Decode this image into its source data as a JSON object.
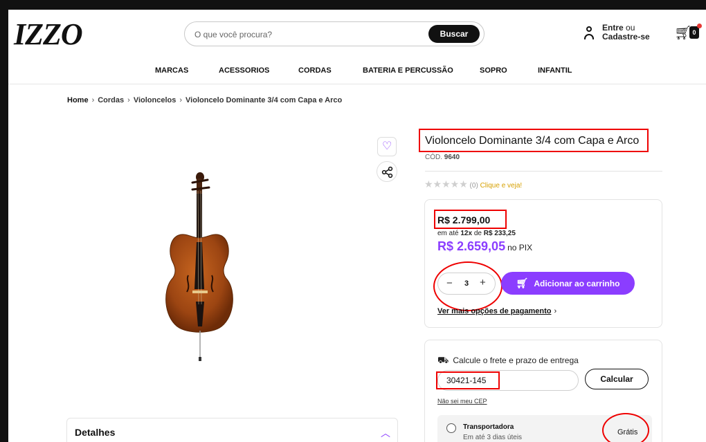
{
  "header": {
    "logo": "IZZO",
    "search_placeholder": "O que você procura?",
    "search_button": "Buscar",
    "account_line1_bold": "Entre",
    "account_line1_rest": " ou",
    "account_line2": "Cadastre-se",
    "cart_count": "0"
  },
  "nav": {
    "items": [
      "MARCAS",
      "ACESSORIOS",
      "CORDAS",
      "BATERIA E PERCUSSÃO",
      "SOPRO",
      "INFANTIL"
    ]
  },
  "breadcrumb": {
    "home": "Home",
    "items": [
      "Cordas",
      "Violoncelos",
      "Violoncelo Dominante 3/4 com Capa e Arco"
    ]
  },
  "product": {
    "title": "Violoncelo Dominante 3/4 com Capa e Arco",
    "code_label": "CÓD.",
    "code_value": "9640",
    "rating_count": "(0)",
    "rating_link": "Clique e veja!",
    "price": "R$ 2.799,00",
    "installment_prefix": "em até ",
    "installment_times": "12x",
    "installment_mid": " de ",
    "installment_value": "R$ 233,25",
    "pix_price": "R$ 2.659,05",
    "pix_label": "no PIX",
    "quantity": "3",
    "add_to_cart": "Adicionar ao carrinho",
    "payment_link": "Ver mais opções de pagamento"
  },
  "shipping": {
    "title": "Calcule o frete e prazo de entrega",
    "cep_value": "30421-145",
    "calc_button": "Calcular",
    "nao_sei": "Não sei meu CEP",
    "option_name": "Transportadora",
    "option_days": "Em até 3 dias úteis",
    "option_price": "Grátis"
  },
  "details": {
    "title": "Detalhes"
  },
  "colors": {
    "accent": "#8b3dff",
    "annotation": "#e00000",
    "rating": "#d6a000"
  }
}
